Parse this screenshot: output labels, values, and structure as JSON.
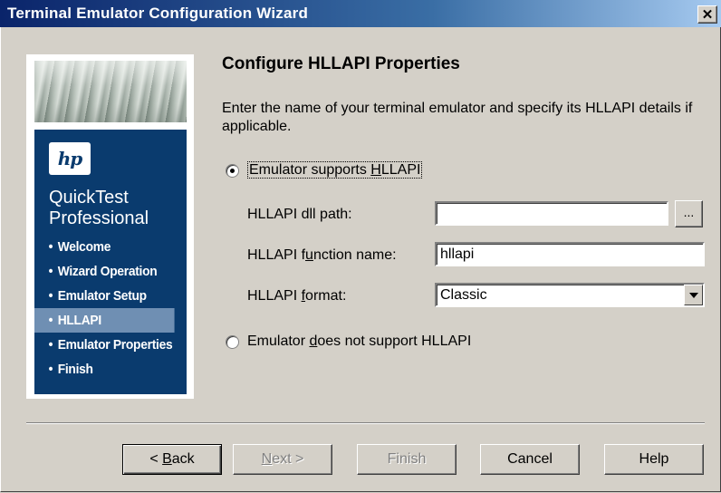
{
  "window": {
    "title": "Terminal Emulator Configuration Wizard",
    "close_glyph": "✕"
  },
  "sidebar": {
    "logo_text": "hp",
    "product_line1": "QuickTest",
    "product_line2": "Professional",
    "items": [
      {
        "label": "Welcome",
        "active": false
      },
      {
        "label": "Wizard Operation",
        "active": false
      },
      {
        "label": "Emulator Setup",
        "active": false
      },
      {
        "label": "HLLAPI",
        "active": true
      },
      {
        "label": "Emulator Properties",
        "active": false
      },
      {
        "label": "Finish",
        "active": false
      }
    ]
  },
  "page": {
    "heading": "Configure HLLAPI Properties",
    "description": "Enter the name of your terminal emulator and specify its HLLAPI details if applicable."
  },
  "options": {
    "supports": {
      "pre": "Emulator supports ",
      "accel": "H",
      "post": "LLAPI",
      "selected": true
    },
    "not_supports": {
      "pre": "Emulator ",
      "accel": "d",
      "post": "oes not support HLLAPI",
      "selected": false
    }
  },
  "fields": {
    "dll_path": {
      "label": "HLLAPI dll path:",
      "value": "",
      "browse": "..."
    },
    "function_name": {
      "pre": "HLLAPI f",
      "accel": "u",
      "post": "nction name:",
      "value": "hllapi"
    },
    "format": {
      "pre": "HLLAPI ",
      "accel": "f",
      "post": "ormat:",
      "value": "Classic"
    }
  },
  "buttons": {
    "back": {
      "lt": "< ",
      "accel": "B",
      "rest": "ack"
    },
    "next": {
      "accel": "N",
      "rest": "ext >"
    },
    "finish": "Finish",
    "cancel": "Cancel",
    "help": "Help"
  }
}
